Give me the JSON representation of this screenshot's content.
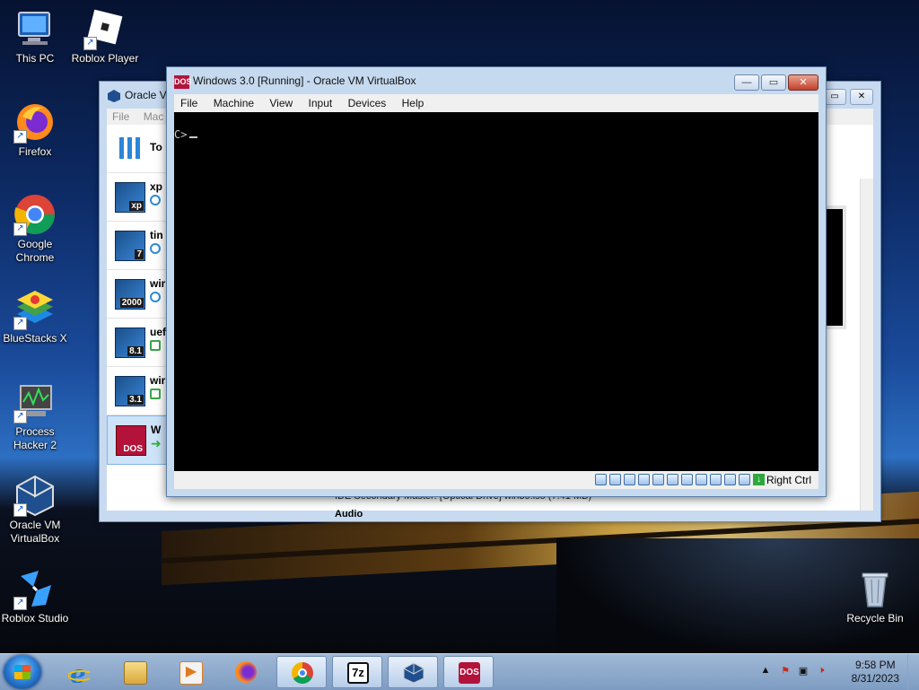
{
  "desktop": {
    "icons": [
      {
        "label": "This PC",
        "icon": "computer-icon"
      },
      {
        "label": "Roblox Player",
        "icon": "roblox-icon"
      },
      {
        "label": "Firefox",
        "icon": "firefox-icon"
      },
      {
        "label": "Google Chrome",
        "icon": "chrome-icon"
      },
      {
        "label": "BlueStacks X",
        "icon": "bluestacks-icon"
      },
      {
        "label": "Process Hacker 2",
        "icon": "process-hacker-icon"
      },
      {
        "label": "Oracle VM VirtualBox",
        "icon": "virtualbox-icon"
      },
      {
        "label": "Roblox Studio",
        "icon": "roblox-studio-icon"
      },
      {
        "label": "Recycle Bin",
        "icon": "recycle-bin-icon"
      }
    ]
  },
  "manager": {
    "title": "Oracle V",
    "menu": [
      "File",
      "Mac"
    ],
    "tools_label": "To",
    "vms": [
      {
        "name": "xp",
        "badge": "xp"
      },
      {
        "name": "tin",
        "badge": "7"
      },
      {
        "name": "wir",
        "badge": "2000"
      },
      {
        "name": "uef",
        "badge": "8.1"
      },
      {
        "name": "wir",
        "badge": "3.1"
      },
      {
        "name": "W",
        "badge": "DOS"
      }
    ],
    "ide_line": "IDE Secondary Master:    [Optical Drive] win30.iso (7.41 MB)",
    "audio_label": "Audio"
  },
  "vm_window": {
    "title": "Windows 3.0 [Running] - Oracle VM VirtualBox",
    "title_icon": "DOS",
    "menu": [
      "File",
      "Machine",
      "View",
      "Input",
      "Devices",
      "Help"
    ],
    "console_prompt": "C>",
    "host_key": "Right Ctrl"
  },
  "taskbar": {
    "apps": [
      "Internet Explorer",
      "File Explorer",
      "Media Player",
      "Firefox",
      "Google Chrome",
      "7-Zip",
      "Oracle VM VirtualBox",
      "DOS"
    ],
    "clock_time": "9:58 PM",
    "clock_date": "8/31/2023"
  },
  "colors": {
    "vm_frame": "#c5d9ef",
    "close_button": "#c2412b",
    "dos_red": "#b3123b"
  }
}
